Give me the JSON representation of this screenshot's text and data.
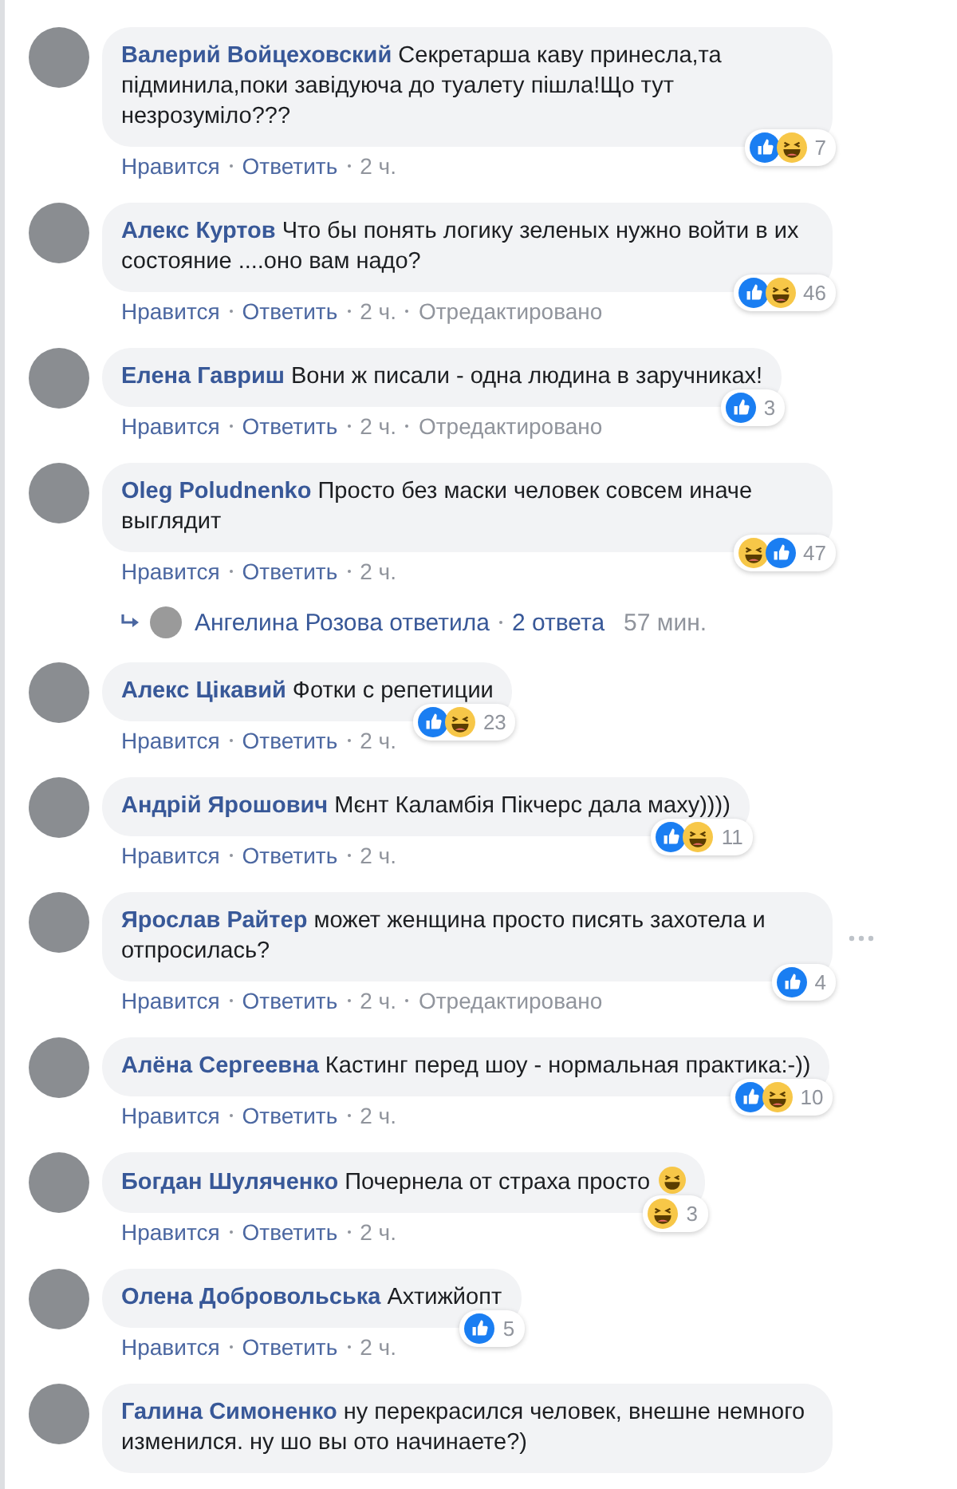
{
  "comments": [
    {
      "author": "Валерий Войцеховский",
      "text": "Секретарша каву принесла,та підминила,поки завідуюча до туалету пішла!Що тут незрозуміло???",
      "actions": [
        "Нравится",
        "Ответить"
      ],
      "time": "2 ч.",
      "reactions": [
        {
          "kind": "like"
        },
        {
          "kind": "haha"
        }
      ],
      "count": "7",
      "show_menu": false
    },
    {
      "author": "Алекс Куртов",
      "text": "Что бы понять логику зеленых нужно войти в их состояние ....оно вам надо?",
      "actions": [
        "Нравится",
        "Ответить"
      ],
      "time": "2 ч.",
      "edited": "Отредактировано",
      "reactions": [
        {
          "kind": "like"
        },
        {
          "kind": "haha"
        }
      ],
      "count": "46",
      "show_menu": false
    },
    {
      "author": "Елена Гавриш",
      "text": "Вони ж писали - одна людина в заручниках!",
      "actions": [
        "Нравится",
        "Ответить"
      ],
      "time": "2 ч.",
      "edited": "Отредактировано",
      "reactions": [
        {
          "kind": "like"
        }
      ],
      "count": "3",
      "show_menu": false
    },
    {
      "author": "Oleg Poludnenko",
      "text": "Просто без маски человек совсем иначе выглядит",
      "actions": [
        "Нравится",
        "Ответить"
      ],
      "time": "2 ч.",
      "reactions": [
        {
          "kind": "haha"
        },
        {
          "kind": "like"
        }
      ],
      "count": "47",
      "show_menu": false,
      "replies": {
        "text": "Ангелина Розова ответила",
        "count": "2 ответа",
        "time": "57 мин."
      }
    },
    {
      "author": "Алекс Цікавий",
      "text": "Фотки с репетиции",
      "actions": [
        "Нравится",
        "Ответить"
      ],
      "time": "2 ч.",
      "reactions": [
        {
          "kind": "like"
        },
        {
          "kind": "haha"
        }
      ],
      "count": "23",
      "show_menu": false
    },
    {
      "author": "Андрій Ярошович",
      "text": "Мєнт Каламбія Пікчерс дала маху))))",
      "actions": [
        "Нравится",
        "Ответить"
      ],
      "time": "2 ч.",
      "reactions": [
        {
          "kind": "like"
        },
        {
          "kind": "haha"
        }
      ],
      "count": "11",
      "show_menu": false
    },
    {
      "author": "Ярослав Райтер",
      "text": "может женщина просто писять захотела и отпросилась?",
      "actions": [
        "Нравится",
        "Ответить"
      ],
      "time": "2 ч.",
      "edited": "Отредактировано",
      "reactions": [
        {
          "kind": "like"
        }
      ],
      "count": "4",
      "show_menu": true
    },
    {
      "author": "Алёна Сергеевна",
      "text": "Кастинг перед шоу - нормальная практика:-))",
      "actions": [
        "Нравится",
        "Ответить"
      ],
      "time": "2 ч.",
      "reactions": [
        {
          "kind": "like"
        },
        {
          "kind": "haha"
        }
      ],
      "count": "10",
      "show_menu": false
    },
    {
      "author": "Богдан Шуляченко",
      "text": "Почернела от страха просто",
      "emoji": {
        "kind": "haha"
      },
      "actions": [
        "Нравится",
        "Ответить"
      ],
      "time": "2 ч.",
      "reactions": [
        {
          "kind": "haha"
        }
      ],
      "count": "3",
      "show_menu": false
    },
    {
      "author": "Олена Добровольська",
      "text": "Ахтижйопт",
      "actions": [
        "Нравится",
        "Ответить"
      ],
      "time": "2 ч.",
      "reactions": [
        {
          "kind": "like"
        }
      ],
      "count": "5",
      "show_menu": false
    },
    {
      "author": "Галина Симоненко",
      "text": "ну перекрасился человек, внешне немного изменился. ну шо вы ото начинаете?)",
      "show_menu": false
    }
  ]
}
